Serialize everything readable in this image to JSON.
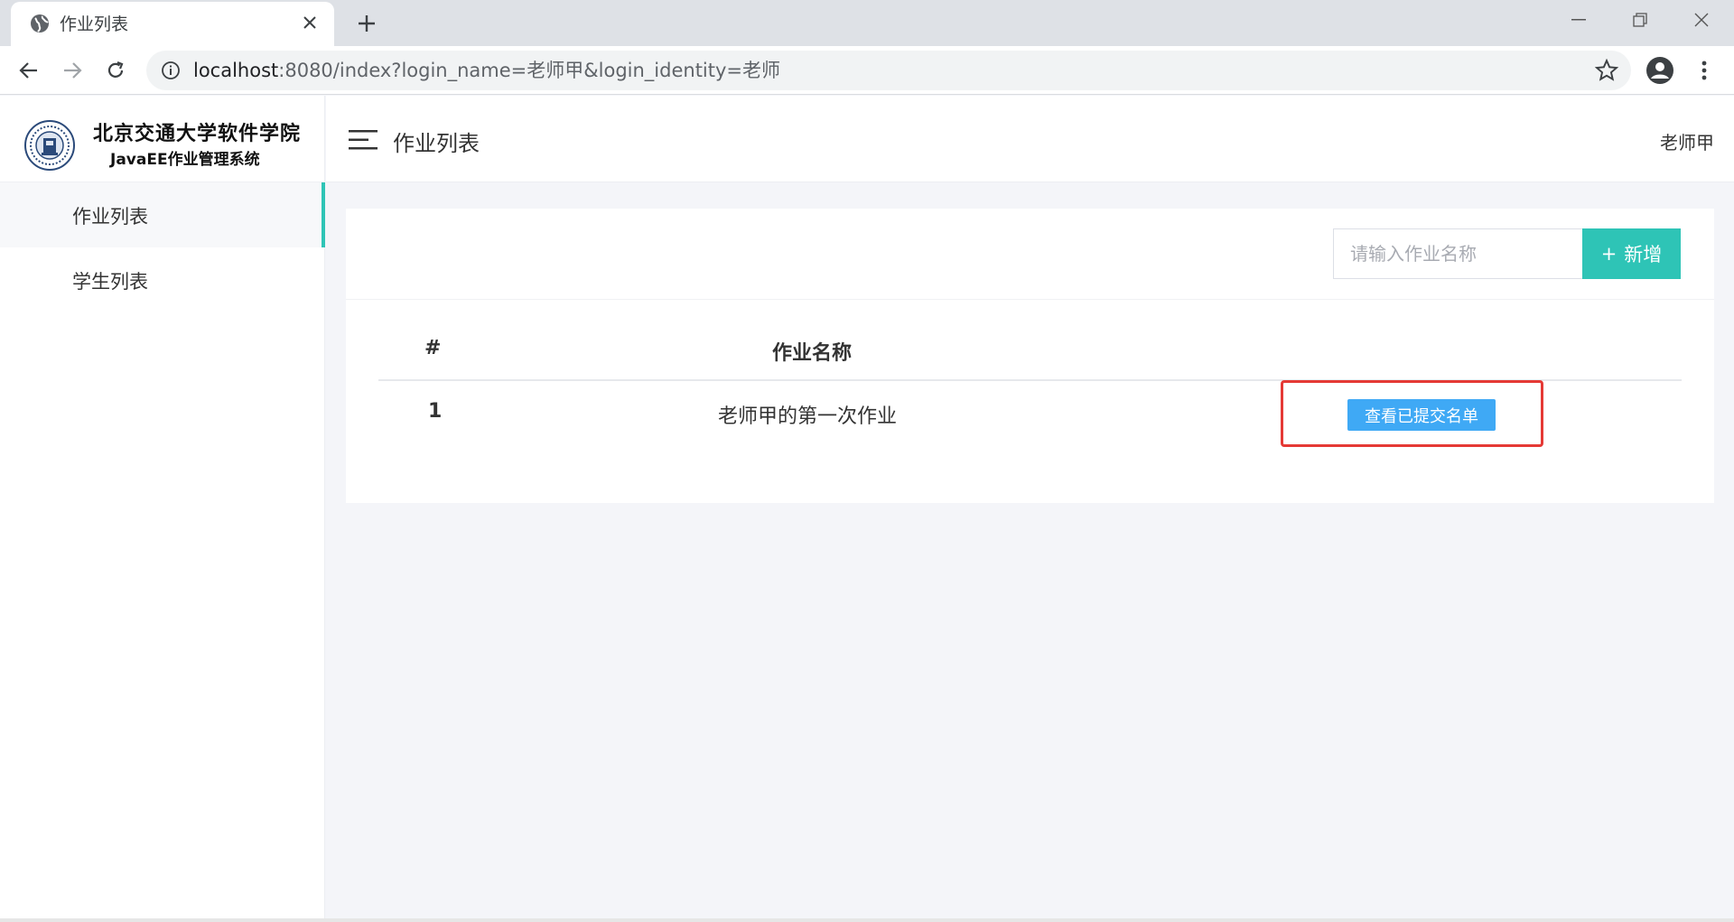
{
  "browser": {
    "tab_title": "作业列表",
    "url_host": "localhost",
    "url_rest": ":8080/index?login_name=老师甲&login_identity=老师"
  },
  "sidebar": {
    "logo_title": "北京交通大学软件学院",
    "logo_subtitle": "JavaEE作业管理系统",
    "items": [
      {
        "label": "作业列表",
        "active": true
      },
      {
        "label": "学生列表",
        "active": false
      }
    ]
  },
  "header": {
    "title": "作业列表",
    "user": "老师甲"
  },
  "toolbar": {
    "search_placeholder": "请输入作业名称",
    "add_icon": "+",
    "add_label": "新增"
  },
  "table": {
    "columns": [
      "#",
      "作业名称",
      ""
    ],
    "rows": [
      {
        "index": "1",
        "name": "老师甲的第一次作业",
        "action_label": "查看已提交名单"
      }
    ]
  },
  "colors": {
    "accent": "#2ec4b6",
    "action_button": "#3fa9f5",
    "highlight": "#e53935"
  }
}
